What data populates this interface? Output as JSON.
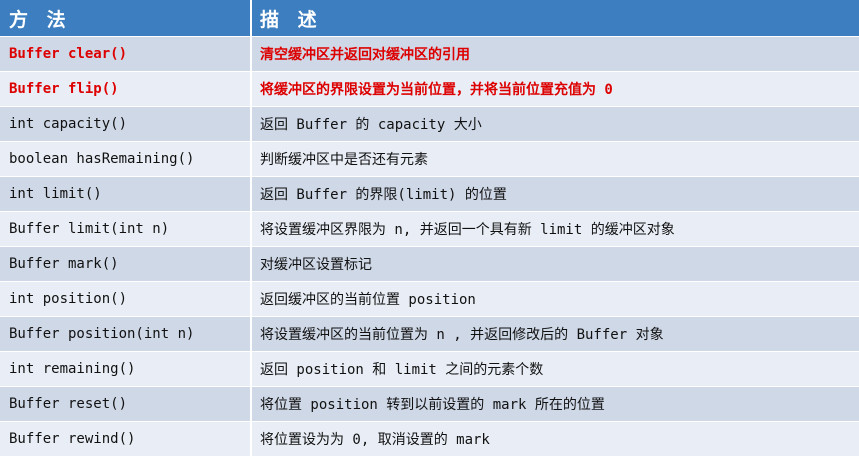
{
  "header": {
    "col_method": "方 法",
    "col_desc": "描 述"
  },
  "rows": [
    {
      "method": "Buffer clear()",
      "desc": "清空缓冲区并返回对缓冲区的引用"
    },
    {
      "method": "Buffer flip()",
      "desc": "将缓冲区的界限设置为当前位置，并将当前位置充值为 0"
    },
    {
      "method": "int capacity()",
      "desc": "返回 Buffer 的 capacity 大小"
    },
    {
      "method": "boolean hasRemaining()",
      "desc": "判断缓冲区中是否还有元素"
    },
    {
      "method": "int limit()",
      "desc": "返回 Buffer 的界限(limit) 的位置"
    },
    {
      "method": "Buffer limit(int n)",
      "desc": "将设置缓冲区界限为 n, 并返回一个具有新 limit 的缓冲区对象"
    },
    {
      "method": "Buffer mark()",
      "desc": "对缓冲区设置标记"
    },
    {
      "method": "int position()",
      "desc": "返回缓冲区的当前位置 position"
    },
    {
      "method": "Buffer position(int n)",
      "desc": "将设置缓冲区的当前位置为 n , 并返回修改后的 Buffer 对象"
    },
    {
      "method": "int remaining()",
      "desc": "返回 position 和 limit 之间的元素个数"
    },
    {
      "method": "Buffer reset()",
      "desc": "将位置 position 转到以前设置的  mark 所在的位置"
    },
    {
      "method": "Buffer rewind()",
      "desc": "将位置设为为 0, 取消设置的 mark"
    }
  ],
  "colors": {
    "header_bg": "#3c7ebf",
    "row_dark": "#cfd8e7",
    "row_light": "#e9eef6",
    "highlight_text": "#dd0000"
  }
}
